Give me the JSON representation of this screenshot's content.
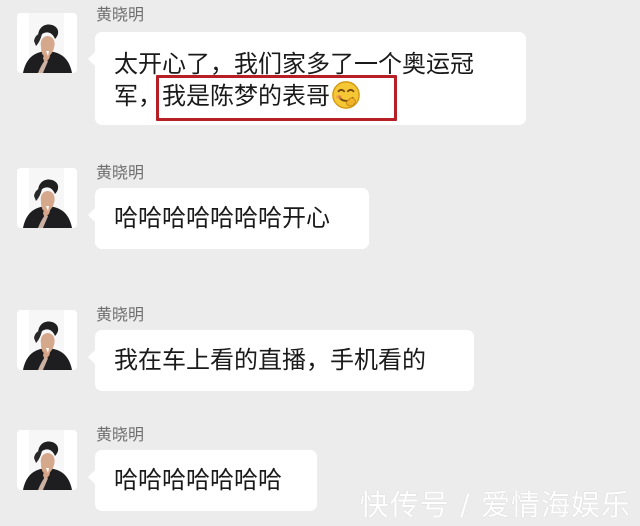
{
  "chat": {
    "messages": [
      {
        "sender": "黄晓明",
        "line_1": "太开心了，我们家多了一个奥运冠",
        "line_2_prefix": "军，",
        "highlight_text": "我是陈梦的表哥",
        "emoji_icon": "grinning-blushing-face-icon"
      },
      {
        "sender": "黄晓明",
        "text": "哈哈哈哈哈哈哈开心"
      },
      {
        "sender": "黄晓明",
        "text": "我在车上看的直播，手机看的"
      },
      {
        "sender": "黄晓明",
        "text": "哈哈哈哈哈哈哈"
      }
    ]
  },
  "watermark": {
    "text": "快传号 / 爱情海娱乐"
  },
  "colors": {
    "background": "#ececec",
    "bubble": "#ffffff",
    "sender_text": "#6f6f6f",
    "message_text": "#1a1a1a",
    "highlight_border": "#b51f25"
  }
}
